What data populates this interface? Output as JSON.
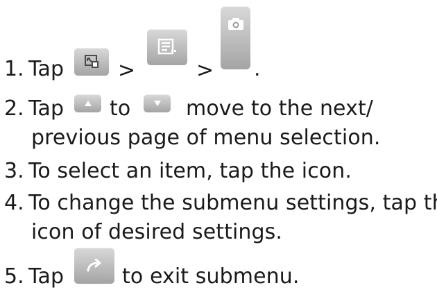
{
  "steps": [
    {
      "number": "1.",
      "text_a": "Tap",
      "sep_1": ">",
      "sep_2": ">",
      "end": ".",
      "icons": [
        "mode-select-icon",
        "menu-list-icon",
        "camera-icon"
      ]
    },
    {
      "number": "2.",
      "text_a": "Tap",
      "text_b": "to",
      "text_c": "move to the next/",
      "line2": "previous page of menu selection.",
      "icons": [
        "arrow-up-icon",
        "arrow-down-icon"
      ]
    },
    {
      "number": "3.",
      "line1": "To select an item, tap the icon."
    },
    {
      "number": "4.",
      "line1": "To change the submenu settings, tap the",
      "line2": "icon of desired settings."
    },
    {
      "number": "5.",
      "text_a": "Tap",
      "text_b": "to exit submenu.",
      "icons": [
        "return-arrow-icon"
      ]
    }
  ]
}
